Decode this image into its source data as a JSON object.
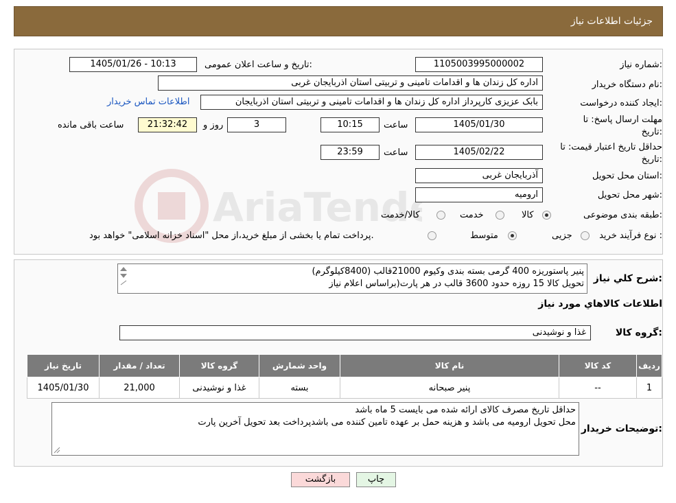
{
  "header": {
    "title": "جزئیات اطلاعات نیاز"
  },
  "form": {
    "need_number_label": "شماره نیاز:",
    "need_number": "1105003995000002",
    "announce_label": "تاریخ و ساعت اعلان عمومی:",
    "announce_value": "1405/01/26 - 10:13",
    "buyer_org_label": "نام دستگاه خریدار:",
    "buyer_org": "اداره کل زندان ها و اقدامات تامینی و تربیتی استان اذربایجان غربی",
    "creator_label": "ایجاد کننده درخواست:",
    "creator": "بابک عزیزی کارپرداز اداره کل زندان ها و اقدامات تامینی و تربیتی استان اذربایجان",
    "contact_link": "اطلاعات تماس خریدار",
    "deadline_label": "مهلت ارسال پاسخ: تا تاریخ:",
    "deadline_date": "1405/01/30",
    "time_label": "ساعت",
    "deadline_time": "10:15",
    "days": "3",
    "days_label": "روز و",
    "remaining": "21:32:42",
    "remaining_label": "ساعت باقی مانده",
    "validity_label": "حداقل تاریخ اعتبار قیمت: تا تاریخ:",
    "validity_date": "1405/02/22",
    "validity_time": "23:59",
    "province_label": "استان محل تحویل:",
    "province": "آذربایجان غربی",
    "city_label": "شهر محل تحویل:",
    "city": "ارومیه",
    "category_label": "طبقه بندی موضوعی:",
    "category_options": [
      "کالا",
      "خدمت",
      "کالا/خدمت"
    ],
    "process_label": "نوع فرآیند خرید :",
    "process_options": [
      "جزیی",
      "متوسط"
    ],
    "process_note": "پرداخت تمام یا بخشی از مبلغ خرید،از محل \"اسناد خزانه اسلامی\" خواهد بود."
  },
  "summary": {
    "label": "شرح کلي نياز:",
    "line1": "پنیر پاستوریزه  400 گرمی بسته بندی وکیوم  21000قالب  (8400کیلوگرم)",
    "line2": "تحویل کالا 15 روزه حدود 3600 قالب در هر پارت(براساس اعلام نیاز"
  },
  "goods": {
    "section_title": "اطلاعات کالاهاي مورد نياز",
    "group_label": "گروه کالا:",
    "group_value": "غذا و نوشیدنی",
    "columns": [
      "ردیف",
      "کد کالا",
      "نام کالا",
      "واحد شمارش",
      "گروه کالا",
      "تعداد / مقدار",
      "تاریخ نیاز"
    ],
    "rows": [
      [
        "1",
        "--",
        "پنیر صبحانه",
        "بسته",
        "غذا و نوشیدنی",
        "21,000",
        "1405/01/30"
      ]
    ]
  },
  "buyer_notes": {
    "label": "توضیحات خریدار:",
    "line1": "حداقل تاریخ مصرف کالای ارائه شده می بایست 5 ماه باشد",
    "line2": "محل تحویل ارومیه می باشد  و هزینه حمل بر عهده تامین کننده می باشدپرداخت بعد تحویل آخرین پارت"
  },
  "buttons": {
    "print": "چاپ",
    "back": "بازگشت"
  },
  "colors": {
    "header_bg": "#8a6a3c",
    "table_header_bg": "#7b7b7b",
    "link": "#1a56c0",
    "back_btn_bg": "#fbd9d9",
    "print_btn_bg": "#e4f6e4"
  },
  "watermark": {
    "text": "AriaTender.neT"
  }
}
